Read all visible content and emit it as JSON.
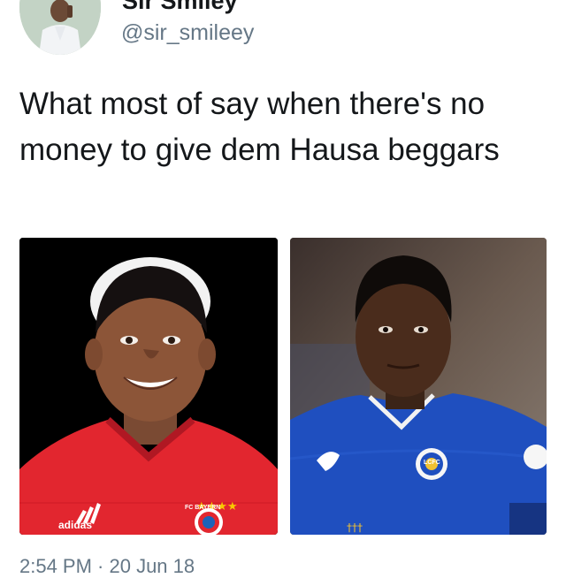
{
  "tweet": {
    "display_name": "Sir Smiley",
    "handle": "@sir_smileey",
    "text": "What most of say when there's no money to give dem Hausa beggars",
    "timestamp": "2:54 PM · 20 Jun 18"
  },
  "media": {
    "left": {
      "kit_brand": "adidas",
      "crest_text": "FC BAYERN"
    },
    "right": {
      "crest_text": "LCFC"
    }
  },
  "colors": {
    "text": "#14171a",
    "secondary_text": "#657786",
    "bayern_red": "#e2262f",
    "leicester_blue": "#1f4fbf"
  }
}
